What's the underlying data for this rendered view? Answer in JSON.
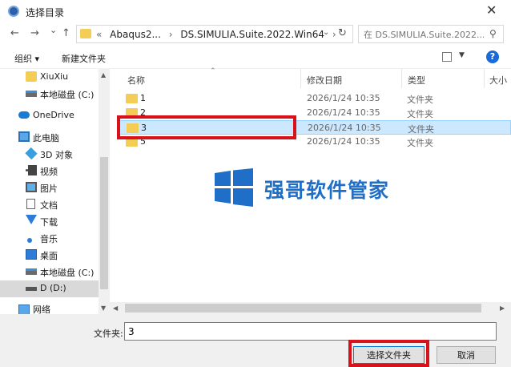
{
  "window": {
    "title": "选择目录",
    "close_glyph": "✕"
  },
  "nav": {
    "back_glyph": "←",
    "forward_glyph": "→",
    "recent_glyph": "⌄",
    "up_glyph": "↑",
    "address_prefix": "«",
    "crumb_1": "Abaqus2...",
    "crumb_sep": "›",
    "crumb_2": "DS.SIMULIA.Suite.2022.Win64",
    "dropdown_glyph": "⌄",
    "refresh_glyph": "↻",
    "search_placeholder": "在 DS.SIMULIA.Suite.2022....",
    "search_glyph": "⚲"
  },
  "toolbar": {
    "organize": "组织 ▾",
    "new_folder": "新建文件夹",
    "view_dropdown": "▼",
    "help": "?"
  },
  "sidebar": {
    "items": [
      {
        "label": "XiuXiu",
        "icon": "folder-icon"
      },
      {
        "label": "本地磁盘 (C:)",
        "icon": "drive-icon"
      },
      {
        "label": "OneDrive",
        "icon": "cloud-icon"
      },
      {
        "label": "此电脑",
        "icon": "computer-icon"
      },
      {
        "label": "3D 对象",
        "icon": "cube-icon"
      },
      {
        "label": "视频",
        "icon": "video-icon"
      },
      {
        "label": "图片",
        "icon": "pictures-icon"
      },
      {
        "label": "文档",
        "icon": "document-icon"
      },
      {
        "label": "下载",
        "icon": "download-icon"
      },
      {
        "label": "音乐",
        "icon": "music-icon"
      },
      {
        "label": "桌面",
        "icon": "desktop-icon"
      },
      {
        "label": "本地磁盘 (C:)",
        "icon": "drive-icon"
      },
      {
        "label": "D (D:)",
        "icon": "drive-icon"
      },
      {
        "label": "网络",
        "icon": "network-icon"
      }
    ]
  },
  "filelist": {
    "columns": [
      "名称",
      "修改日期",
      "类型",
      "大小"
    ],
    "rows": [
      {
        "name": "1",
        "date": "2026/1/24 10:35",
        "type": "文件夹"
      },
      {
        "name": "2",
        "date": "2026/1/24 10:35",
        "type": "文件夹"
      },
      {
        "name": "3",
        "date": "2026/1/24 10:35",
        "type": "文件夹",
        "selected": true
      },
      {
        "name": "5",
        "date": "2026/1/24 10:35",
        "type": "文件夹"
      }
    ]
  },
  "footer": {
    "folder_label": "文件夹:",
    "folder_value": "3",
    "select_button": "选择文件夹",
    "cancel_button": "取消"
  },
  "watermark": {
    "text": "强哥软件管家"
  },
  "colors": {
    "highlight_red": "#d8121a",
    "selection_blue": "#cce8ff",
    "folder_yellow": "#f4cd57",
    "brand_blue": "#1f6fc9"
  }
}
